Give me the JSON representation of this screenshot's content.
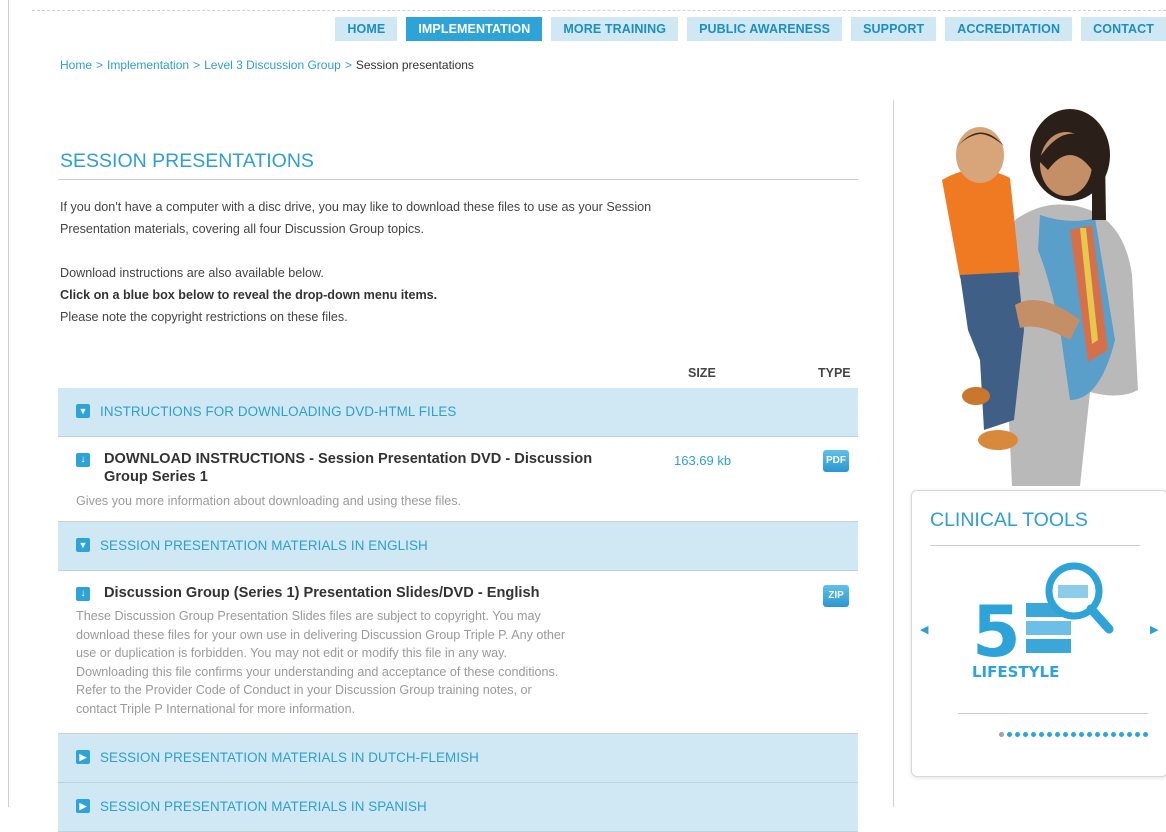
{
  "nav": {
    "items": [
      "HOME",
      "IMPLEMENTATION",
      "MORE TRAINING",
      "PUBLIC AWARENESS",
      "SUPPORT",
      "ACCREDITATION",
      "CONTACT"
    ],
    "active": "IMPLEMENTATION"
  },
  "breadcrumb": {
    "items": [
      "Home",
      "Implementation",
      "Level 3 Discussion Group"
    ],
    "current": "Session presentations",
    "separator": ">"
  },
  "page": {
    "title": "SESSION PRESENTATIONS",
    "intro_1": "If you don't have a computer with a disc drive, you may like to download these files to use as your Session",
    "intro_2": "Presentation materials, covering all four Discussion Group topics.",
    "intro_3": "Download instructions are also available below.",
    "intro_4": "Click on a blue box below to reveal the drop-down menu items.",
    "intro_5": "Please note the copyright restrictions on these files."
  },
  "table": {
    "col_size": "SIZE",
    "col_type": "TYPE",
    "sections": [
      {
        "label": "INSTRUCTIONS FOR DOWNLOADING DVD-HTML FILES",
        "expanded": true,
        "items": [
          {
            "title_lines": [
              "DOWNLOAD INSTRUCTIONS - Session Presentation DVD - Discussion",
              "Group Series 1"
            ],
            "size": "163.69 kb",
            "type": "PDF",
            "desc_lines": [
              "Gives you more information about downloading and using these files."
            ]
          }
        ]
      },
      {
        "label": "SESSION PRESENTATION MATERIALS IN ENGLISH",
        "expanded": true,
        "items": [
          {
            "title_lines": [
              "Discussion Group (Series 1) Presentation Slides/DVD - English"
            ],
            "size": "",
            "type": "ZIP",
            "desc_lines": [
              "These Discussion Group Presentation Slides files are subject to copyright. You may",
              "download these files for your own use in delivering Discussion Group Triple P. Any other",
              "use or duplication is forbidden. You may not edit or modify this file in any way.",
              "Downloading this file confirms your understanding and acceptance of these conditions.",
              "Refer to the Provider Code of Conduct in your Discussion Group training notes, or",
              "contact Triple P International for more information."
            ]
          }
        ]
      },
      {
        "label": "SESSION PRESENTATION MATERIALS IN DUTCH-FLEMISH",
        "expanded": false,
        "items": []
      },
      {
        "label": "SESSION PRESENTATION MATERIALS IN SPANISH",
        "expanded": false,
        "items": []
      }
    ]
  },
  "sidebar": {
    "clinical_tools": {
      "heading": "CLINICAL TOOLS",
      "slide_number": "5",
      "slide_caption": "LIFESTYLE",
      "dots_total": 19,
      "dots_active": 0
    }
  },
  "colors": {
    "accent": "#2ea3d8",
    "nav_bg": "#cfe8f3",
    "link": "#2d9fd2"
  },
  "icons": {
    "section_collapsed": "chevron-right-icon",
    "section_expanded": "chevron-down-icon",
    "download": "download-arrow-icon",
    "pdf": "pdf-file-icon",
    "zip": "zip-file-icon"
  }
}
